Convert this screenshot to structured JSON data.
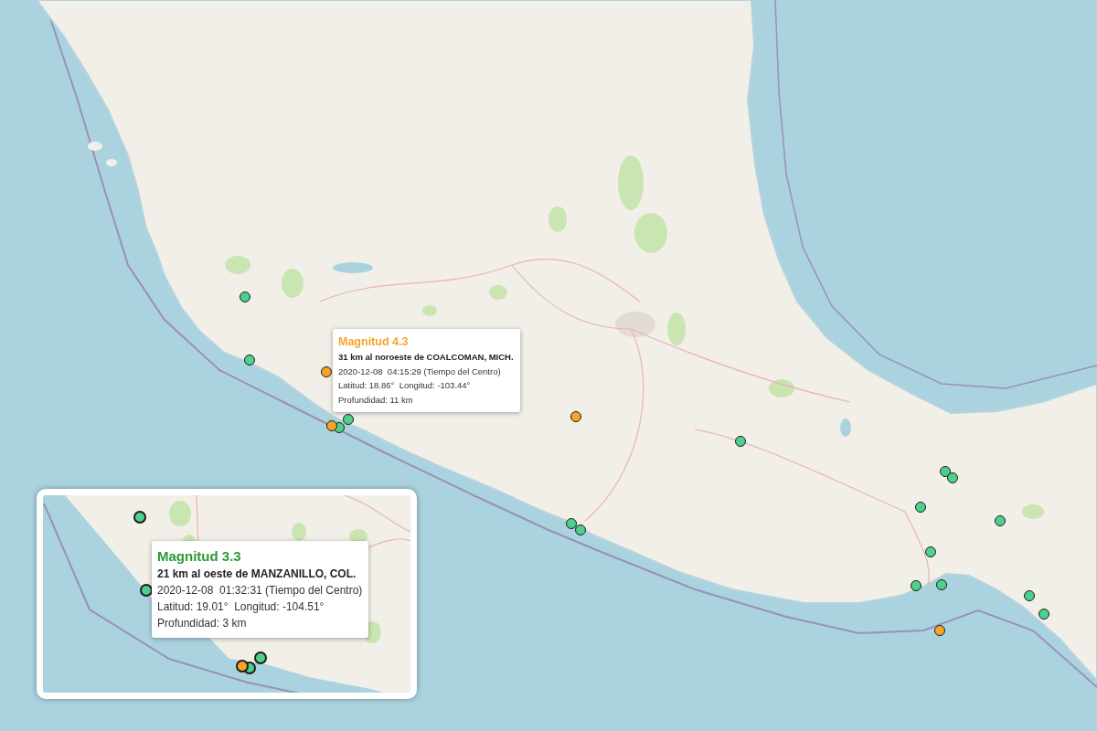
{
  "map": {
    "markers": [
      {
        "color": "#4fd08c"
      },
      {
        "color": "#4fd08c"
      },
      {
        "color": "#f6a524"
      },
      {
        "color": "#4fd08c"
      },
      {
        "color": "#4fd08c"
      },
      {
        "color": "#f6a524"
      },
      {
        "color": "#f6a524"
      },
      {
        "color": "#4fd08c"
      },
      {
        "color": "#4fd08c"
      },
      {
        "color": "#4fd08c"
      },
      {
        "color": "#4fd08c"
      },
      {
        "color": "#4fd08c"
      },
      {
        "color": "#4fd08c"
      },
      {
        "color": "#4fd08c"
      },
      {
        "color": "#4fd08c"
      },
      {
        "color": "#4fd08c"
      },
      {
        "color": "#4fd08c"
      },
      {
        "color": "#4fd08c"
      },
      {
        "color": "#4fd08c"
      },
      {
        "color": "#f6a524"
      }
    ],
    "popup": {
      "title": "Magnitud 4.3",
      "color": "#f5a623",
      "location": "31 km al noroeste de COALCOMAN, MICH.",
      "datetime": "2020-12-08  04:15:29 (Tiempo del Centro)",
      "coordinates": "Latitud: 18.86°  Longitud: -103.44°",
      "depth": "Profundidad: 11 km"
    }
  },
  "inset": {
    "markers": [
      {
        "color": "#4fd08c"
      },
      {
        "color": "#4fd08c"
      },
      {
        "color": "#4fd08c"
      },
      {
        "color": "#4fd08c"
      },
      {
        "color": "#f6a524"
      }
    ],
    "popup": {
      "title": "Magnitud 3.3",
      "color": "#2b9a33",
      "location": "21 km al oeste de MANZANILLO, COL.",
      "datetime": "2020-12-08  01:32:31 (Tiempo del Centro)",
      "coordinates": "Latitud: 19.01°  Longitud: -104.51°",
      "depth": "Profundidad: 3 km"
    }
  }
}
